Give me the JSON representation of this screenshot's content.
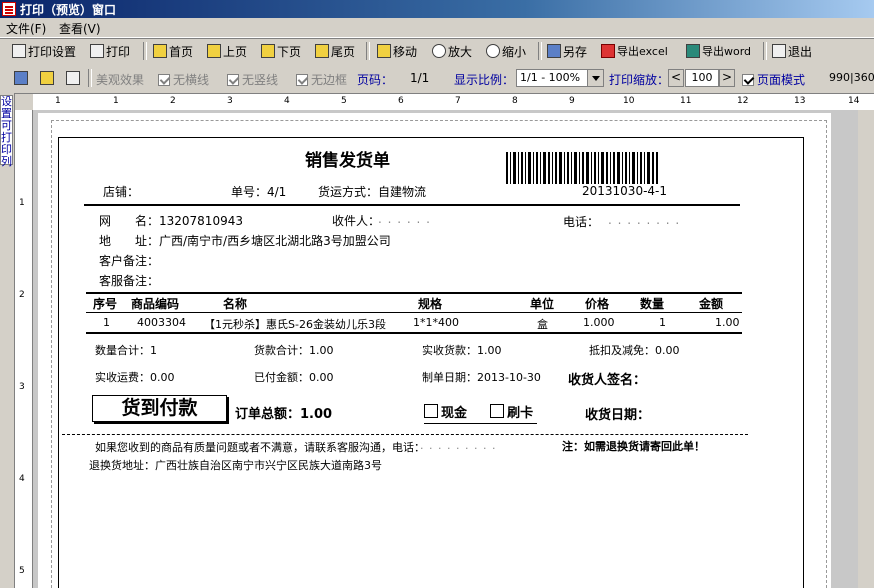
{
  "window": {
    "title": "打印（预览）窗口"
  },
  "menu": {
    "file": "文件(F)",
    "view": "查看(V)"
  },
  "toolbar": {
    "print_setup": "打印设置",
    "print": "打印",
    "first": "首页",
    "prev": "上页",
    "next": "下页",
    "last": "尾页",
    "move": "移动",
    "zoom_in": "放大",
    "zoom_out": "缩小",
    "save_as": "另存",
    "export_excel": "导出excel",
    "export_word": "导出word",
    "exit": "退出"
  },
  "toolbar2": {
    "beauty": "美观效果",
    "no_hline": "无横线",
    "no_vline": "无竖线",
    "no_border": "无边框",
    "page_label": "页码：",
    "page_value": "1/1",
    "scale_label": "显示比例：",
    "scale_value": "1/1 - 100%",
    "print_scale_label": "打印缩放：",
    "print_scale_value": "100",
    "page_mode": "页面模式",
    "size_readout": "990|360"
  },
  "side": {
    "printable_columns": "设置可打印列"
  },
  "rulers": {
    "h_ticks": [
      "1",
      "1",
      "2",
      "3",
      "4",
      "5",
      "6",
      "7",
      "8",
      "9",
      "10",
      "11",
      "12",
      "13",
      "14"
    ],
    "v_ticks": [
      "1",
      "2",
      "3",
      "4",
      "5"
    ]
  },
  "doc": {
    "title": "销售发货单",
    "barcode_number": "20131030-4-1",
    "store_label": "店铺：",
    "order_no_label": "单号：4/1",
    "shipping_label": "货运方式：自建物流",
    "web_name_label": "网　　名：13207810943",
    "receiver_label": "收件人：",
    "phone_label": "电话：",
    "address_label": "地　　址：广西/南宁市/西乡塘区北湖北路3号加盟公司",
    "customer_note_label": "客户备注：",
    "service_note_label": "客服备注：",
    "table": {
      "headers": [
        "序号",
        "商品编码",
        "名称",
        "规格",
        "单位",
        "价格",
        "数量",
        "金额"
      ],
      "rows": [
        [
          "1",
          "4003304",
          "【1元秒杀】惠氏S-26金装幼儿乐3段",
          "1*1*400",
          "盒",
          "1.000",
          "1",
          "1.00"
        ]
      ]
    },
    "qty_total": "数量合计：1",
    "goods_total": "货款合计：1.00",
    "received_goods": "实收货款：1.00",
    "discount": "抵扣及减免：0.00",
    "received_freight": "实收运费：0.00",
    "paid_amount": "已付金额：0.00",
    "created_date": "制单日期：2013-10-30",
    "receiver_signature": "收货人签名：",
    "cod": "货到付款",
    "order_total": "订单总额：1.00",
    "cash": "现金",
    "card": "刷卡",
    "receive_date": "收货日期：",
    "quality_note": "如果您收到的商品有质量问题或者不满意，请联系客服沟通，电话：",
    "return_note": "注：如需退换货请寄回此单！",
    "return_address": "退换货地址：广西壮族自治区南宁市兴宁区民族大道南路3号"
  },
  "colors": {
    "title_bar": "#0a246a",
    "face": "#d4d0c8",
    "label_blue": "#0000a0"
  }
}
